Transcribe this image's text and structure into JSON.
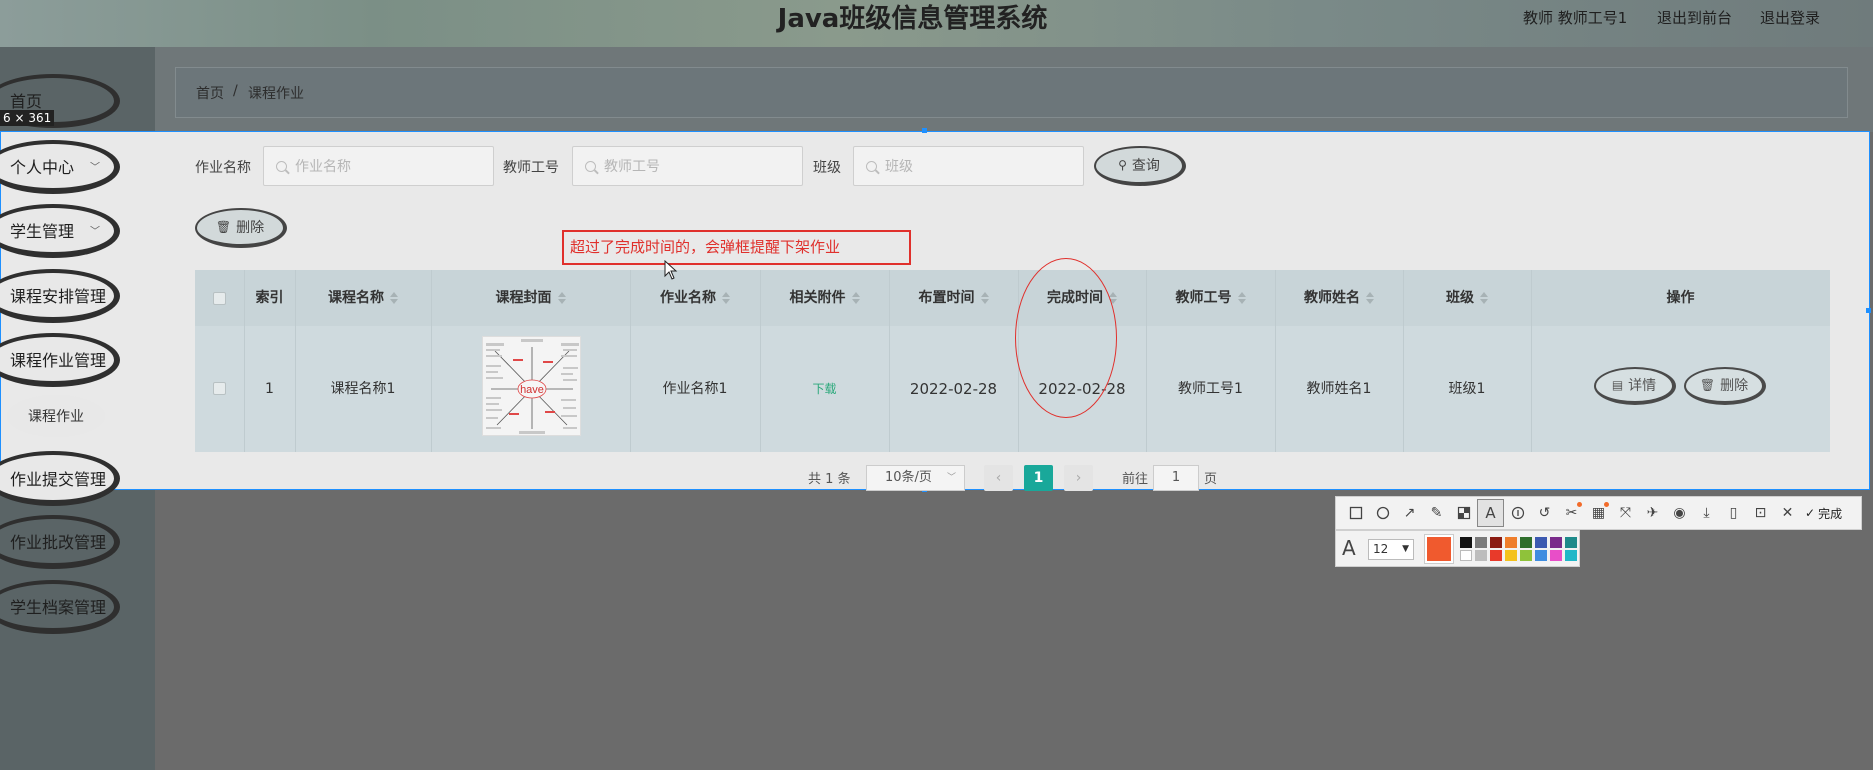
{
  "header": {
    "title": "Java班级信息管理系统",
    "user_label": "教师 教师工号1",
    "back_to_front": "退出到前台",
    "logout": "退出登录"
  },
  "sidebar": {
    "size_label": "6 × 361",
    "items": [
      {
        "label": "首页"
      },
      {
        "label": "个人中心"
      },
      {
        "label": "学生管理"
      },
      {
        "label": "课程安排管理"
      },
      {
        "label": "课程作业管理"
      },
      {
        "label": "课程作业"
      },
      {
        "label": "作业提交管理"
      },
      {
        "label": "作业批改管理"
      },
      {
        "label": "学生档案管理"
      }
    ]
  },
  "breadcrumb": {
    "home": "首页",
    "separator": "/",
    "current": "课程作业"
  },
  "search": {
    "name_label": "作业名称",
    "name_placeholder": "作业名称",
    "teacher_label": "教师工号",
    "teacher_placeholder": "教师工号",
    "class_label": "班级",
    "class_placeholder": "班级",
    "query_button": "查询"
  },
  "actions": {
    "delete_button": "删除"
  },
  "annotation": {
    "text": "超过了完成时间的，会弹框提醒下架作业",
    "color": "#e0302c"
  },
  "table": {
    "headers": [
      "索引",
      "课程名称",
      "课程封面",
      "作业名称",
      "相关附件",
      "布置时间",
      "完成时间",
      "教师工号",
      "教师姓名",
      "班级",
      "操作"
    ],
    "rows": [
      {
        "index": "1",
        "course_name": "课程名称1",
        "cover_text": "have",
        "homework_name": "作业名称1",
        "attachment": "下载",
        "assign_time": "2022-02-28",
        "finish_time": "2022-02-28",
        "teacher_no": "教师工号1",
        "teacher_name": "教师姓名1",
        "class": "班级1",
        "detail_button": "详情",
        "delete_button": "删除"
      }
    ]
  },
  "pagination": {
    "total": "共 1 条",
    "page_size": "10条/页",
    "current_page": "1",
    "goto_label": "前往",
    "goto_value": "1",
    "page_unit": "页",
    "accent": "#19a89a"
  },
  "screenshot_tool": {
    "done_label": "完成",
    "font_size": "12",
    "current_color": "#f05a2e",
    "tools": [
      "rectangle-icon",
      "ellipse-icon",
      "arrow-icon",
      "pen-icon",
      "mosaic-icon",
      "text-icon",
      "number-icon",
      "undo-icon",
      "cut-icon",
      "ocr-icon",
      "expand-icon",
      "pin-icon",
      "record-icon",
      "save-icon",
      "phone-icon",
      "bookmark-icon",
      "close-icon",
      "check-icon"
    ],
    "palette": [
      "#111111",
      "#7a7a7a",
      "#8b1c12",
      "#ef7d2a",
      "#2f6e2c",
      "#3c59b0",
      "#7a2b8a",
      "#1e8a8a",
      "#ffffff",
      "#bdbdbd",
      "#e83a2a",
      "#f4c21c",
      "#8fc23a",
      "#3f8de0",
      "#e84ec8",
      "#20b7c8"
    ]
  }
}
